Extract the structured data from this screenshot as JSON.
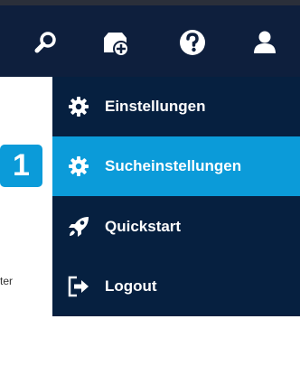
{
  "header": {
    "icons": [
      {
        "name": "search-icon"
      },
      {
        "name": "package-add-icon"
      },
      {
        "name": "help-icon"
      },
      {
        "name": "user-icon"
      }
    ]
  },
  "menu": {
    "items": [
      {
        "label": "Einstellungen",
        "icon": "gear-icon",
        "active": false
      },
      {
        "label": "Sucheinstellungen",
        "icon": "gear-icon",
        "active": true
      },
      {
        "label": "Quickstart",
        "icon": "rocket-icon",
        "active": false
      },
      {
        "label": "Logout",
        "icon": "logout-icon",
        "active": false
      }
    ]
  },
  "annotation": {
    "step_number": "1"
  },
  "background": {
    "partial_text": "ter"
  },
  "colors": {
    "navbar": "#0e1f3d",
    "dropdown": "#062040",
    "accent": "#0b9bd9"
  }
}
